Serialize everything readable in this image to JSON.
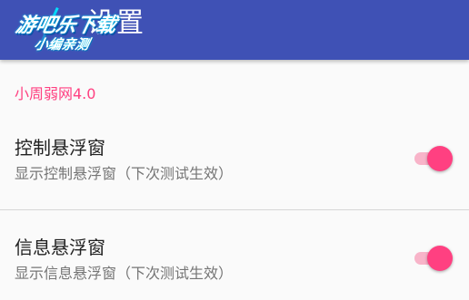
{
  "app_bar": {
    "title": "设置",
    "color": "#3f51b5"
  },
  "watermark": {
    "line1": "游吧乐下载",
    "line2": "小编亲测"
  },
  "category": {
    "label": "小周弱网4.0",
    "color": "#ff4081"
  },
  "preferences": [
    {
      "title": "控制悬浮窗",
      "summary": "显示控制悬浮窗（下次测试生效）",
      "checked": true
    },
    {
      "title": "信息悬浮窗",
      "summary": "显示信息悬浮窗（下次测试生效）",
      "checked": true
    }
  ]
}
